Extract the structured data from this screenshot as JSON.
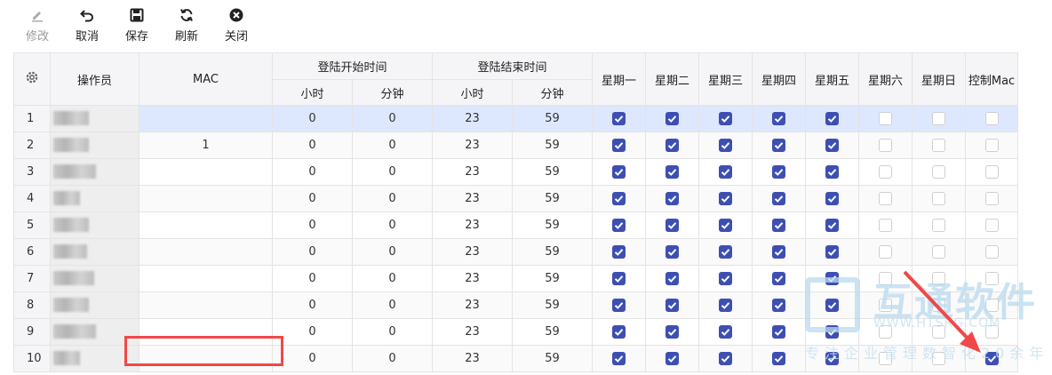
{
  "toolbar": {
    "edit": "修改",
    "cancel": "取消",
    "save": "保存",
    "refresh": "刷新",
    "close": "关闭"
  },
  "table": {
    "headers": {
      "operator": "操作员",
      "mac": "MAC",
      "login_start": "登陆开始时间",
      "login_end": "登陆结束时间",
      "hour": "小时",
      "minute": "分钟",
      "days": [
        "星期一",
        "星期二",
        "星期三",
        "星期四",
        "星期五",
        "星期六",
        "星期日"
      ],
      "control_mac": "控制Mac"
    },
    "rows": [
      {
        "no": "1",
        "mac": "",
        "sh": "0",
        "sm": "0",
        "eh": "23",
        "em": "59",
        "days": [
          true,
          true,
          true,
          true,
          true,
          false,
          false
        ],
        "ctrl": false
      },
      {
        "no": "2",
        "mac": "1",
        "sh": "0",
        "sm": "0",
        "eh": "23",
        "em": "59",
        "days": [
          true,
          true,
          true,
          true,
          true,
          false,
          false
        ],
        "ctrl": false
      },
      {
        "no": "3",
        "mac": "",
        "sh": "0",
        "sm": "0",
        "eh": "23",
        "em": "59",
        "days": [
          true,
          true,
          true,
          true,
          true,
          false,
          false
        ],
        "ctrl": false
      },
      {
        "no": "4",
        "mac": "",
        "sh": "0",
        "sm": "0",
        "eh": "23",
        "em": "59",
        "days": [
          true,
          true,
          true,
          true,
          true,
          false,
          false
        ],
        "ctrl": false
      },
      {
        "no": "5",
        "mac": "",
        "sh": "0",
        "sm": "0",
        "eh": "23",
        "em": "59",
        "days": [
          true,
          true,
          true,
          true,
          true,
          false,
          false
        ],
        "ctrl": false
      },
      {
        "no": "6",
        "mac": "",
        "sh": "0",
        "sm": "0",
        "eh": "23",
        "em": "59",
        "days": [
          true,
          true,
          true,
          true,
          true,
          false,
          false
        ],
        "ctrl": false
      },
      {
        "no": "7",
        "mac": "",
        "sh": "0",
        "sm": "0",
        "eh": "23",
        "em": "59",
        "days": [
          true,
          true,
          true,
          true,
          true,
          false,
          false
        ],
        "ctrl": false
      },
      {
        "no": "8",
        "mac": "",
        "sh": "0",
        "sm": "0",
        "eh": "23",
        "em": "59",
        "days": [
          true,
          true,
          true,
          true,
          true,
          false,
          false
        ],
        "ctrl": false
      },
      {
        "no": "9",
        "mac": "",
        "sh": "0",
        "sm": "0",
        "eh": "23",
        "em": "59",
        "days": [
          true,
          true,
          true,
          true,
          true,
          false,
          false
        ],
        "ctrl": false
      },
      {
        "no": "10",
        "mac": "",
        "sh": "0",
        "sm": "0",
        "eh": "23",
        "em": "59",
        "days": [
          true,
          true,
          true,
          true,
          true,
          false,
          false
        ],
        "ctrl": true
      }
    ]
  },
  "watermark": {
    "name": "互通软件",
    "url": "WWW.HTSRG.COM",
    "slogan": "专注企业管理数智化20余年"
  },
  "colors": {
    "checkbox_checked": "#3e4fb3",
    "selected_row": "#dde8ff",
    "highlight": "#f04848"
  }
}
